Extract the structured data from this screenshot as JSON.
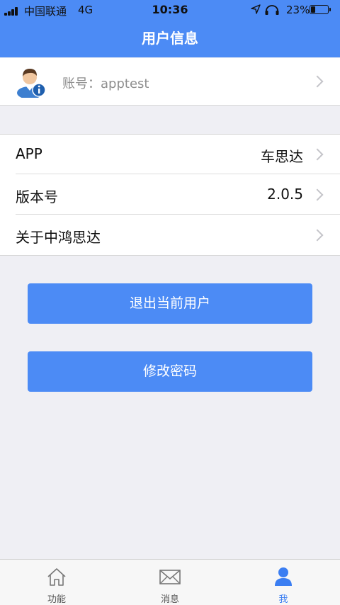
{
  "status_bar": {
    "carrier": "中国联通",
    "network": "4G",
    "time": "10:36",
    "battery": "23%"
  },
  "header": {
    "title": "用户信息"
  },
  "account": {
    "label": "账号：apptest"
  },
  "info_list": [
    {
      "label": "APP",
      "value": "车思达"
    },
    {
      "label": "版本号",
      "value": "2.0.5"
    },
    {
      "label": "关于中鸿思达",
      "value": ""
    }
  ],
  "buttons": {
    "logout": "退出当前用户",
    "change_password": "修改密码"
  },
  "tabbar": {
    "items": [
      {
        "label": "功能",
        "icon": "home-icon"
      },
      {
        "label": "消息",
        "icon": "envelope-icon"
      },
      {
        "label": "我",
        "icon": "person-icon"
      }
    ],
    "active_color": "#3b7ef2"
  },
  "colors": {
    "primary": "#4c8bf5",
    "background": "#efeff4"
  }
}
